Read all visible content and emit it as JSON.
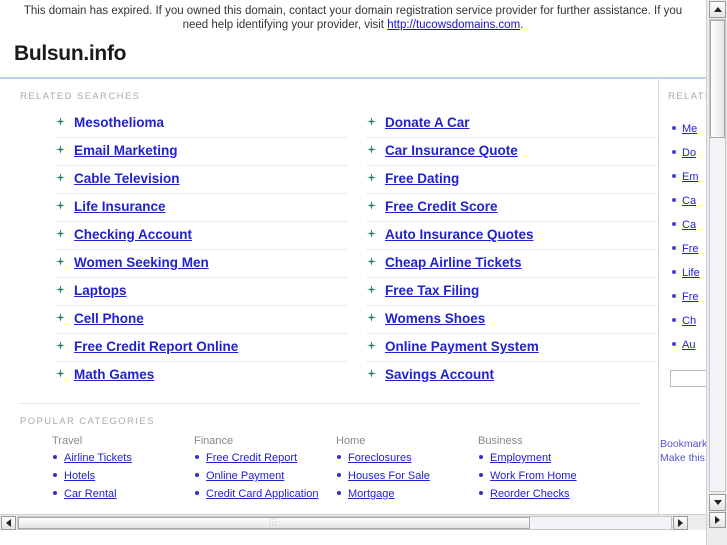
{
  "notice": {
    "text_before": "This domain has expired. If you owned this domain, contact your domain registration service provider for further assistance. If you need help identifying your provider, visit ",
    "link_text": "http://tucowsdomains.com",
    "text_after": "."
  },
  "site": {
    "title": "Bulsun.info"
  },
  "related": {
    "label": "RELATED SEARCHES",
    "column_left": [
      "Mesothelioma",
      "Email Marketing",
      "Cable Television",
      "Life Insurance",
      "Checking Account",
      "Women Seeking Men",
      "Laptops",
      "Cell Phone",
      "Free Credit Report Online",
      "Math Games"
    ],
    "column_right": [
      "Donate A Car",
      "Car Insurance Quote",
      "Free Dating",
      "Free Credit Score",
      "Auto Insurance Quotes",
      "Cheap Airline Tickets",
      "Free Tax Filing",
      "Womens Shoes",
      "Online Payment System",
      "Savings Account"
    ]
  },
  "categories": {
    "label": "POPULAR CATEGORIES",
    "groups": [
      {
        "heading": "Travel",
        "items": [
          "Airline Tickets",
          "Hotels",
          "Car Rental"
        ]
      },
      {
        "heading": "Finance",
        "items": [
          "Free Credit Report",
          "Online Payment",
          "Credit Card Application"
        ]
      },
      {
        "heading": "Home",
        "items": [
          "Foreclosures",
          "Houses For Sale",
          "Mortgage"
        ]
      },
      {
        "heading": "Business",
        "items": [
          "Employment",
          "Work From Home",
          "Reorder Checks"
        ]
      }
    ]
  },
  "rail": {
    "label": "RELATED",
    "items": [
      "Me",
      "Do",
      "Em",
      "Ca",
      "Ca",
      "Fre",
      "Life",
      "Fre",
      "Ch",
      "Au"
    ],
    "search_value": "",
    "search_placeholder": "",
    "footer_lines": [
      "Bookmark",
      "Make this"
    ]
  },
  "colors": {
    "link": "#2222cc",
    "notice_link": "#1a10c8",
    "marker": "#2f8f5b",
    "rule": "#b9d2ef",
    "label": "#aaaaaa"
  }
}
